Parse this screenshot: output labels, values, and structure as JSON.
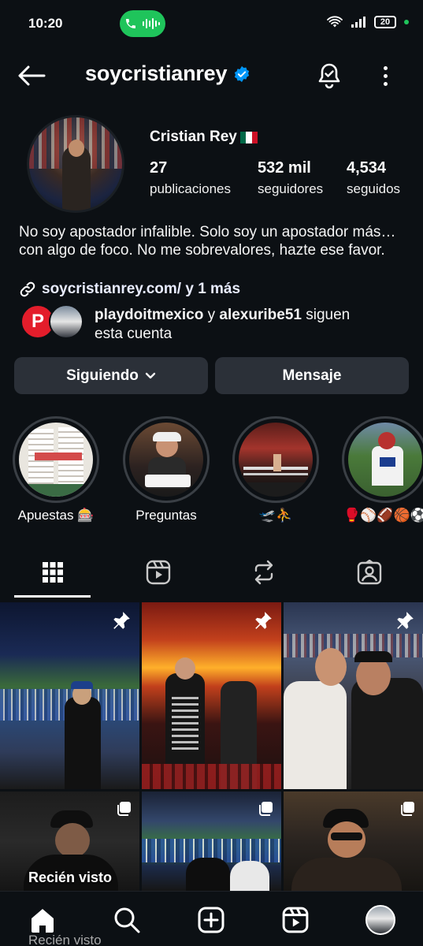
{
  "status_bar": {
    "time": "10:20",
    "battery": "20"
  },
  "header": {
    "username": "soycristianrey",
    "back_icon": "arrow-left-icon",
    "verified_icon": "verified-badge-icon",
    "bell_icon": "bell-icon",
    "more_icon": "more-vertical-icon"
  },
  "profile": {
    "display_name": "Cristian Rey",
    "stats": [
      {
        "value": "27",
        "label": "publicaciones"
      },
      {
        "value": "532 mil",
        "label": "seguidores"
      },
      {
        "value": "4,534",
        "label": "seguidos"
      }
    ],
    "bio": "No soy apostador infalible. Solo soy un apostador más… con algo de foco. No me sobrevalores, hazte ese favor.",
    "link": "soycristianrey.com/ y 1 más",
    "followed_by": {
      "user1": "playdoitmexico",
      "connector": " y ",
      "user2": "alexuribe51",
      "suffix": " siguen esta cuenta"
    }
  },
  "buttons": {
    "following": "Siguiendo",
    "message": "Mensaje"
  },
  "highlights": [
    {
      "label": "Apuestas 🎰"
    },
    {
      "label": "Preguntas"
    },
    {
      "label": "🛫⛹️"
    },
    {
      "label": "🥊⚾🏈🏀⚽"
    }
  ],
  "tabs": [
    "grid-icon",
    "reels-icon",
    "reposts-icon",
    "tagged-icon"
  ],
  "grid": {
    "recent_label": "Recién visto",
    "ghost_label": "Recién visto"
  },
  "bottom_nav": [
    "home-icon",
    "search-icon",
    "create-icon",
    "reels-icon",
    "profile-avatar"
  ],
  "colors": {
    "background": "#0c1014",
    "button": "#2b3038",
    "verified": "#0095f6",
    "call": "#1fc45b"
  }
}
